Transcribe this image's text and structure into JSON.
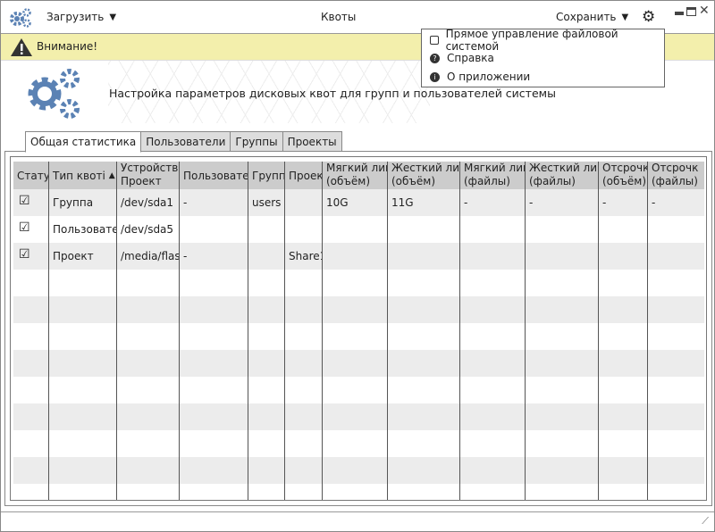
{
  "titlebar": {
    "load_label": "Загрузить",
    "title": "Квоты",
    "save_label": "Сохранить"
  },
  "warning": {
    "text": "Внимание!"
  },
  "header": {
    "text": "Настройка параметров дисковых квот для групп и пользователей системы"
  },
  "menu": {
    "items": [
      {
        "label": "Прямое управление файловой системой",
        "icon": "checkbox-icon",
        "checked": false
      },
      {
        "label": "Справка",
        "icon": "help-icon"
      },
      {
        "label": "О приложении",
        "icon": "info-icon"
      }
    ]
  },
  "tabs": [
    {
      "label": "Общая статистика",
      "active": true
    },
    {
      "label": "Пользователи"
    },
    {
      "label": "Группы"
    },
    {
      "label": "Проекты"
    }
  ],
  "table": {
    "columns": [
      [
        "Стату",
        ""
      ],
      [
        "Тип квоті",
        ""
      ],
      [
        "Устройство",
        "Проект"
      ],
      [
        "Пользовате.",
        ""
      ],
      [
        "Группі",
        ""
      ],
      [
        "Проек",
        ""
      ],
      [
        "Мягкий лимі",
        "(объём)"
      ],
      [
        "Жесткий лим",
        "(объём)"
      ],
      [
        "Мягкий лимі",
        "(файлы)"
      ],
      [
        "Жесткий лим",
        "(файлы)"
      ],
      [
        "Отсрочк",
        "(объём)"
      ],
      [
        "Отсрочк",
        "(файлы)"
      ]
    ],
    "sort_column": "Тип квоті",
    "sort_direction": "ascending",
    "rows": [
      [
        "☑",
        "Группа",
        "/dev/sda1",
        "-",
        "users",
        "",
        "10G",
        "11G",
        "-",
        "-",
        "-",
        "-"
      ],
      [
        "☑",
        "Пользовате.",
        "/dev/sda5",
        "",
        "",
        "",
        "",
        "",
        "",
        "",
        "",
        ""
      ],
      [
        "☑",
        "Проект",
        "/media/flas",
        "-",
        "",
        "Share1",
        "",
        "",
        "",
        "",
        "",
        ""
      ]
    ]
  },
  "colors": {
    "accent": "#5b82b4",
    "warning_bg": "#f3efac",
    "header_bg": "#cccccc",
    "stripe": "#ececec"
  }
}
